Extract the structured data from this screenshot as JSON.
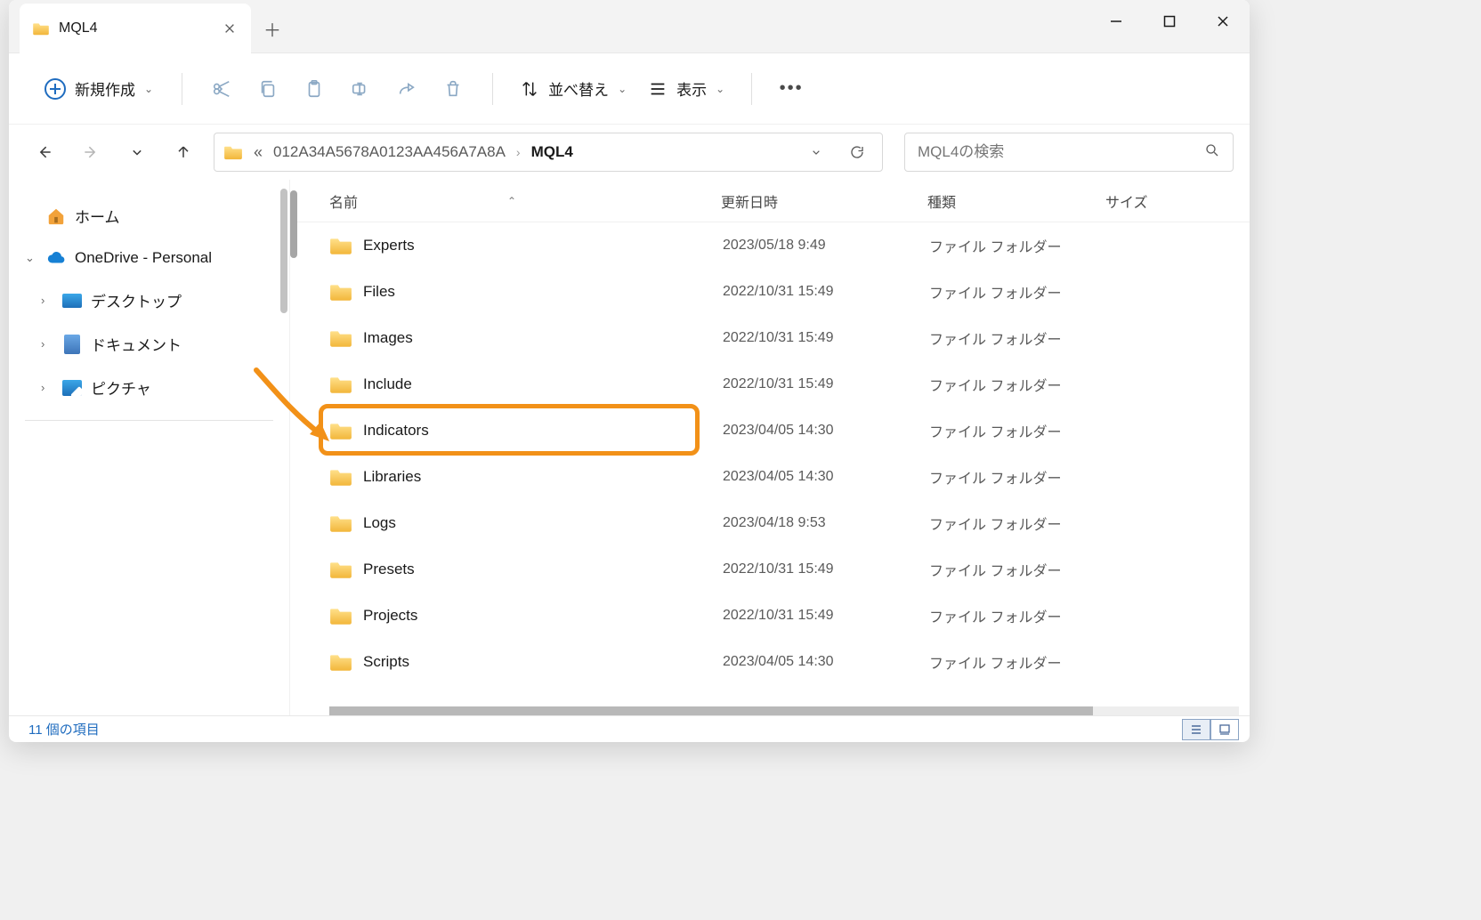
{
  "tab": {
    "title": "MQL4"
  },
  "toolbar": {
    "new_label": "新規作成",
    "sort_label": "並べ替え",
    "view_label": "表示"
  },
  "addressbar": {
    "segment": "012A34A5678A0123AA456A7A8A",
    "current": "MQL4"
  },
  "search": {
    "placeholder": "MQL4の検索"
  },
  "sidebar": {
    "home": "ホーム",
    "onedrive": "OneDrive - Personal",
    "desktop": "デスクトップ",
    "documents": "ドキュメント",
    "pictures": "ピクチャ"
  },
  "columns": {
    "name": "名前",
    "date": "更新日時",
    "type": "種類",
    "size": "サイズ"
  },
  "rows": [
    {
      "name": "Experts",
      "date": "2023/05/18 9:49",
      "type": "ファイル フォルダー"
    },
    {
      "name": "Files",
      "date": "2022/10/31 15:49",
      "type": "ファイル フォルダー"
    },
    {
      "name": "Images",
      "date": "2022/10/31 15:49",
      "type": "ファイル フォルダー"
    },
    {
      "name": "Include",
      "date": "2022/10/31 15:49",
      "type": "ファイル フォルダー"
    },
    {
      "name": "Indicators",
      "date": "2023/04/05 14:30",
      "type": "ファイル フォルダー"
    },
    {
      "name": "Libraries",
      "date": "2023/04/05 14:30",
      "type": "ファイル フォルダー"
    },
    {
      "name": "Logs",
      "date": "2023/04/18 9:53",
      "type": "ファイル フォルダー"
    },
    {
      "name": "Presets",
      "date": "2022/10/31 15:49",
      "type": "ファイル フォルダー"
    },
    {
      "name": "Projects",
      "date": "2022/10/31 15:49",
      "type": "ファイル フォルダー"
    },
    {
      "name": "Scripts",
      "date": "2023/04/05 14:30",
      "type": "ファイル フォルダー"
    }
  ],
  "highlight_index": 4,
  "status": {
    "count_text": "11 個の項目"
  }
}
